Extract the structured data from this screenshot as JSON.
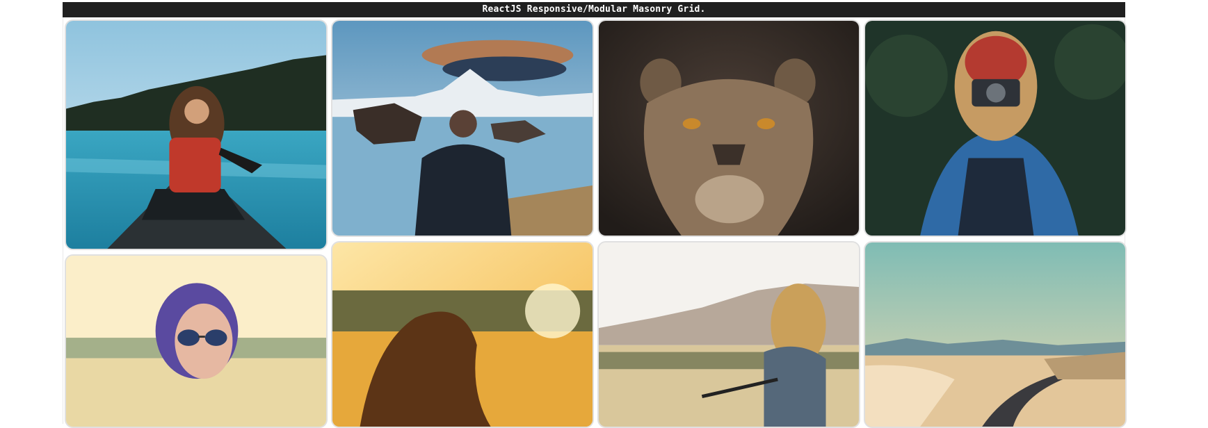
{
  "app": {
    "title": "ReactJS Responsive/Modular Masonry Grid."
  },
  "grid": {
    "columns": 4,
    "items": [
      {
        "subject": "woman in red jacket paddling canoe on lake with pine forest"
      },
      {
        "subject": "man in black jacket facing mountain lake with rocks"
      },
      {
        "subject": "lioness face close-up on dark background"
      },
      {
        "subject": "woman in red beanie and denim shirt taking photo with camera"
      },
      {
        "subject": "woman with sunglasses in bright field"
      },
      {
        "subject": "woman with long hair in golden sunset field"
      },
      {
        "subject": "woman riding bicycle in front of hills"
      },
      {
        "subject": "desert road winding through sand dunes"
      }
    ]
  },
  "colors": {
    "header_bg": "#202020",
    "header_text": "#ffffff",
    "tile_border": "#e0e0e0"
  }
}
